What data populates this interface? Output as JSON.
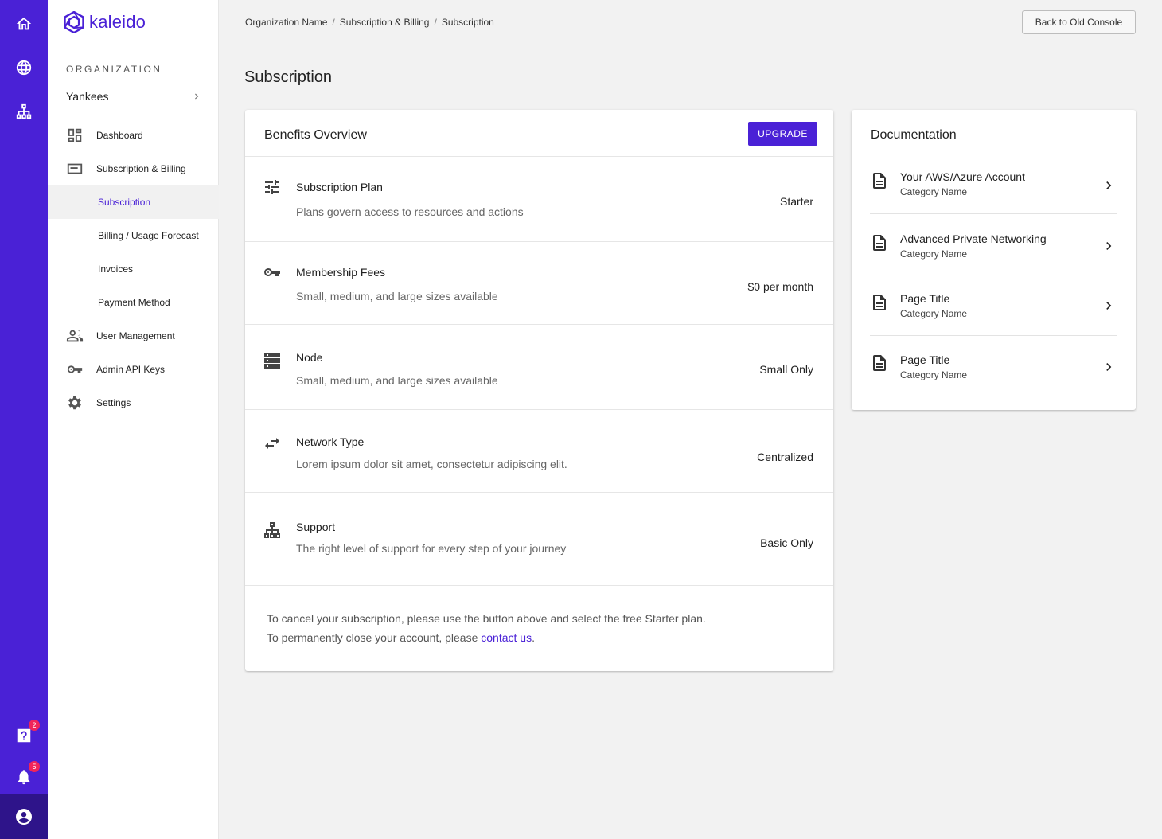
{
  "brand": {
    "name": "kaleido",
    "color": "#4a21d6"
  },
  "rail": {
    "help_badge": "2",
    "notifications_badge": "5"
  },
  "sidebar": {
    "org_label": "ORGANIZATION",
    "org_name": "Yankees",
    "items": [
      {
        "label": "Dashboard"
      },
      {
        "label": "Subscription & Billing"
      },
      {
        "label": "Subscription"
      },
      {
        "label": "Billing / Usage Forecast"
      },
      {
        "label": "Invoices"
      },
      {
        "label": "Payment Method"
      },
      {
        "label": "User Management"
      },
      {
        "label": "Admin API Keys"
      },
      {
        "label": "Settings"
      }
    ]
  },
  "breadcrumb": [
    "Organization Name",
    "Subscription & Billing",
    "Subscription"
  ],
  "header": {
    "old_console_label": "Back to Old Console"
  },
  "page": {
    "title": "Subscription"
  },
  "benefits": {
    "title": "Benefits Overview",
    "upgrade_label": "UPGRADE",
    "rows": [
      {
        "title": "Subscription Plan",
        "description": "Plans govern access to resources and actions",
        "value": "Starter"
      },
      {
        "title": "Membership Fees",
        "description": "Small, medium, and large sizes available",
        "value": "$0 per month"
      },
      {
        "title": "Node",
        "description": "Small, medium, and large sizes available",
        "value": "Small Only"
      },
      {
        "title": "Network Type",
        "description": "Lorem ipsum dolor sit amet, consectetur adipiscing elit.",
        "value": "Centralized"
      },
      {
        "title": "Support",
        "description": "The right level of support for every step of your journey",
        "value": "Basic Only"
      }
    ],
    "footnote_line1": "To cancel your subscription, please use the button above and select the free Starter plan.",
    "footnote_line2": "To permanently close your account, please",
    "contact_link": "contact us",
    "footnote_end": "."
  },
  "documentation": {
    "title": "Documentation",
    "items": [
      {
        "title": "Your AWS/Azure Account",
        "category": "Category Name"
      },
      {
        "title": "Advanced Private Networking",
        "category": "Category Name"
      },
      {
        "title": "Page Title",
        "category": "Category Name"
      },
      {
        "title": "Page Title",
        "category": "Category Name"
      }
    ]
  }
}
